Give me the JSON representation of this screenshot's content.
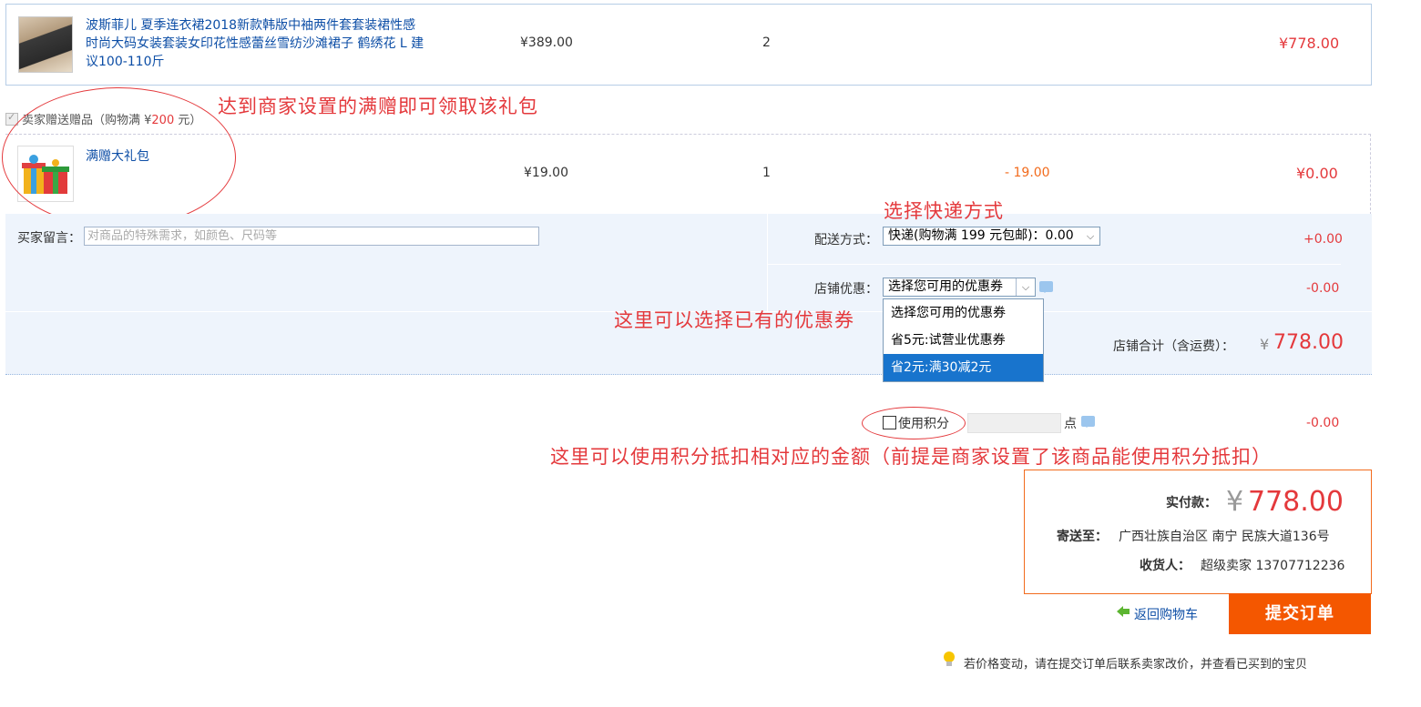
{
  "product": {
    "name": "波斯菲儿 夏季连衣裙2018新款韩版中袖两件套套装裙性感时尚大码女装套装女印花性感蕾丝雪纺沙滩裙子 鹤绣花 L 建议100-110斤",
    "price": "¥389.00",
    "qty": "2",
    "subtotal": "¥778.00"
  },
  "gift": {
    "header_prefix": "卖家赠送赠品（购物满 ¥",
    "header_amount": "200",
    "header_suffix": " 元）",
    "name": "满赠大礼包",
    "price": "¥19.00",
    "qty": "1",
    "discount": "- 19.00",
    "subtotal": "¥0.00"
  },
  "order": {
    "message_label": "买家留言：",
    "message_placeholder": "对商品的特殊需求，如颜色、尺码等",
    "shipping_label": "配送方式：",
    "shipping_value": "快递(购物满 199 元包邮)：0.00",
    "shipping_amount": "+0.00",
    "coupon_label": "店铺优惠：",
    "coupon_value": "选择您可用的优惠券",
    "coupon_amount": "-0.00",
    "coupon_options": [
      "选择您可用的优惠券",
      "省5元:试营业优惠券",
      "省2元:满30减2元"
    ],
    "store_total_label": "店铺合计（含运费）：",
    "store_total_currency": "¥",
    "store_total_value": "778.00"
  },
  "points": {
    "label": "使用积分",
    "unit": "点",
    "amount": "-0.00"
  },
  "payment": {
    "label": "实付款：",
    "currency": "¥",
    "value": "778.00",
    "ship_to_label": "寄送至：",
    "ship_to_value": "广西壮族自治区 南宁 民族大道136号",
    "receiver_label": "收货人：",
    "receiver_value": "超级卖家 13707712236"
  },
  "actions": {
    "back_to_cart": "返回购物车",
    "submit": "提交订单",
    "tip": "若价格变动，请在提交订单后联系卖家改价，并查看已买到的宝贝"
  },
  "annotations": {
    "gift": "达到商家设置的满赠即可领取该礼包",
    "shipping": "选择快递方式",
    "coupon": "这里可以选择已有的优惠券",
    "points": "这里可以使用积分抵扣相对应的金额（前提是商家设置了该商品能使用积分抵扣）"
  },
  "colors": {
    "accent_red": "#e4393c",
    "submit_orange": "#f45700",
    "panel_blue": "#eef4fc",
    "link_blue": "#0d4ea6"
  }
}
